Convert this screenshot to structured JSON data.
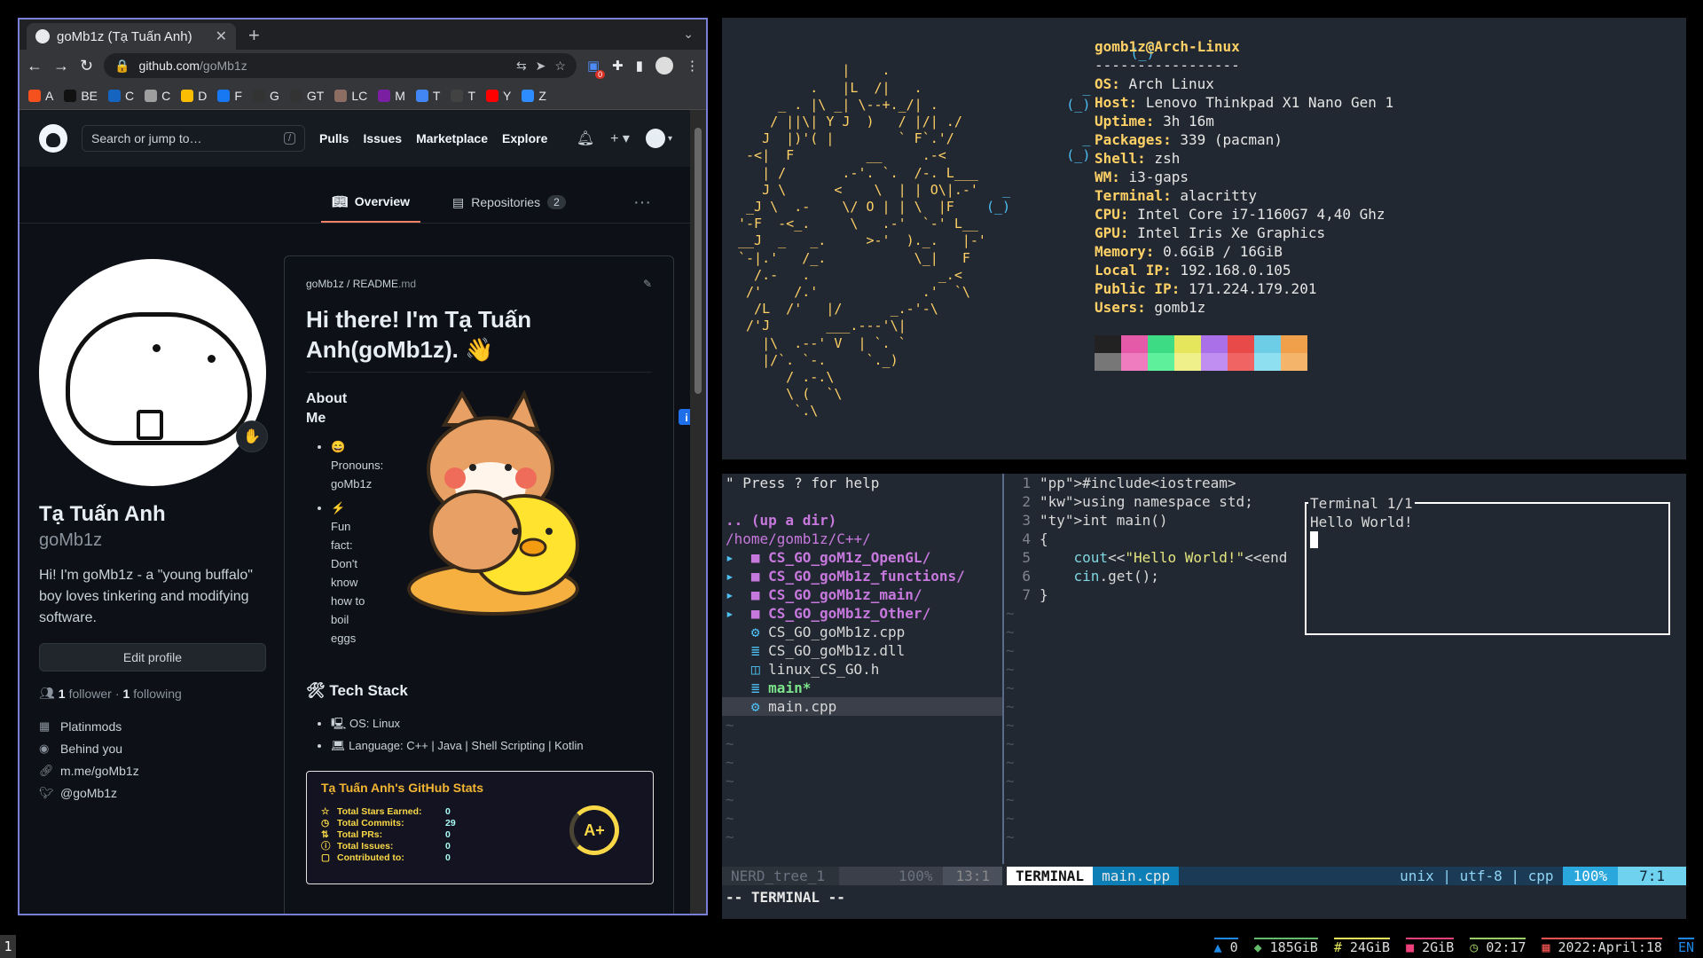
{
  "browser": {
    "tab_title": "goMb1z (Tạ Tuấn Anh)",
    "url_host": "github.com",
    "url_path": "/goMb1z",
    "bookmarks": [
      {
        "label": "A",
        "color": "#f4511e"
      },
      {
        "label": "BE",
        "color": "#111111"
      },
      {
        "label": "C",
        "color": "#1565c0"
      },
      {
        "label": "C",
        "color": "#9e9e9e"
      },
      {
        "label": "D",
        "color": "#fbbc04"
      },
      {
        "label": "F",
        "color": "#1877f2"
      },
      {
        "label": "G",
        "color": "#333333"
      },
      {
        "label": "GT",
        "color": "#333333"
      },
      {
        "label": "LC",
        "color": "#8d6e63"
      },
      {
        "label": "M",
        "color": "#7b1fa2"
      },
      {
        "label": "T",
        "color": "#4285f4"
      },
      {
        "label": "T",
        "color": "#424242"
      },
      {
        "label": "Y",
        "color": "#ff0000"
      },
      {
        "label": "Z",
        "color": "#2d8cff"
      }
    ],
    "ext_badge": "0"
  },
  "github": {
    "search_placeholder": "Search or jump to…",
    "search_key": "/",
    "nav": [
      "Pulls",
      "Issues",
      "Marketplace",
      "Explore"
    ],
    "tabs": {
      "overview": "Overview",
      "repositories": "Repositories",
      "repo_count": "2"
    },
    "profile": {
      "name": "Tạ Tuấn Anh",
      "login": "goMb1z",
      "bio": "Hi! I'm goMb1z - a \"young buffalo\" boy loves tinkering and modifying software.",
      "edit": "Edit profile",
      "followers": "1",
      "followers_label": "follower",
      "following": "1",
      "following_label": "following",
      "org": "Platinmods",
      "location": "Behind you",
      "link": "m.me/goMb1z",
      "twitter": "@goMb1z"
    },
    "readme": {
      "owner": "goMb1z",
      "file": "README",
      "ext": ".md",
      "heading": "Hi there! I'm Tạ Tuấn Anh(goMb1z). 👋",
      "about_title": "About Me",
      "about_items": [
        "😄 Pronouns: goMb1z",
        "⚡ Fun fact: Don't know how to boil eggs"
      ],
      "tech_title": "Tech Stack",
      "tech_items": [
        "OS: Linux",
        "Language: C++ | Java | Shell Scripting | Kotlin"
      ],
      "stats": {
        "title": "Tạ Tuấn Anh's GitHub Stats",
        "rows": [
          {
            "label": "Total Stars Earned:",
            "value": "0"
          },
          {
            "label": "Total Commits:",
            "value": "29"
          },
          {
            "label": "Total PRs:",
            "value": "0"
          },
          {
            "label": "Total Issues:",
            "value": "0"
          },
          {
            "label": "Contributed to:",
            "value": "0"
          }
        ],
        "grade": "A+"
      }
    }
  },
  "neofetch": {
    "user_host": "gomb1z@Arch-Linux",
    "separator": "-----------------",
    "fields": [
      {
        "k": "OS",
        "v": "Arch Linux"
      },
      {
        "k": "Host",
        "v": "Lenovo Thinkpad X1 Nano Gen 1"
      },
      {
        "k": "Uptime",
        "v": "3h 16m"
      },
      {
        "k": "Packages",
        "v": "339 (pacman)"
      },
      {
        "k": "Shell",
        "v": "zsh"
      },
      {
        "k": "WM",
        "v": "i3-gaps"
      },
      {
        "k": "Terminal",
        "v": "alacritty"
      },
      {
        "k": "CPU",
        "v": "Intel Core i7-1160G7 4,40 Ghz"
      },
      {
        "k": "GPU",
        "v": "Intel Iris Xe Graphics"
      },
      {
        "k": "Memory",
        "v": "0.6GiB / 16GiB"
      },
      {
        "k": "Local IP",
        "v": "192.168.0.105"
      },
      {
        "k": "Public IP",
        "v": "171.224.179.201"
      },
      {
        "k": "Users",
        "v": "gomb1z"
      }
    ],
    "colors_top": [
      "#222222",
      "#e55aa8",
      "#3ddc84",
      "#e6e65c",
      "#a970e8",
      "#e84a4a",
      "#6ecde6",
      "#f0a04b"
    ],
    "colors_bottom": [
      "#777777",
      "#f07cc0",
      "#5ef09a",
      "#f0f08a",
      "#c08ef0",
      "#f06464",
      "#8ee0f0",
      "#f4b46a"
    ]
  },
  "vim": {
    "help": "\" Press ? for help",
    "updir": ".. (up a dir)",
    "cwd": "/home/gomb1z/C++/",
    "entries": [
      {
        "type": "dir",
        "name": "CS_GO_goM1z_OpenGL/"
      },
      {
        "type": "dir",
        "name": "CS_GO_goMb1z_functions/"
      },
      {
        "type": "dir",
        "name": "CS_GO_goMb1z_main/"
      },
      {
        "type": "dir",
        "name": "CS_GO_goMb1z_Other/"
      },
      {
        "type": "file",
        "icon": "⚙",
        "name": "CS_GO_goMb1z.cpp"
      },
      {
        "type": "file",
        "icon": "≣",
        "name": "CS_GO_goMb1z.dll"
      },
      {
        "type": "file",
        "icon": "◫",
        "name": "linux_CS_GO.h"
      },
      {
        "type": "exe",
        "icon": "≣",
        "name": "main*"
      },
      {
        "type": "file",
        "icon": "⚙",
        "name": "main.cpp"
      }
    ],
    "code": [
      "#include<iostream>",
      "using namespace std;",
      "int main()",
      "{",
      "    cout<<\"Hello World!\"<<end",
      "    cin.get();",
      "}"
    ],
    "term_title": "Terminal 1/1",
    "term_out": "Hello World!",
    "status_left": {
      "name": "NERD_tree_1",
      "pct": "100%",
      "pos": "13:1"
    },
    "status_right": {
      "mode": "TERMINAL",
      "file": "main.cpp",
      "enc": "unix | utf-8 | cpp",
      "pct": "100%",
      "pos": "7:1"
    },
    "modeline": "-- TERMINAL --"
  },
  "bar": {
    "workspace": "1",
    "blocks": [
      {
        "icon": "▲",
        "text": "0",
        "color": "#1e88e5"
      },
      {
        "icon": "◆",
        "text": "185GiB",
        "color": "#66bb6a"
      },
      {
        "icon": "#",
        "text": "24GiB",
        "color": "#e6e65c"
      },
      {
        "icon": "■",
        "text": "2GiB",
        "color": "#ec407a"
      },
      {
        "icon": "◷",
        "text": "02:17",
        "color": "#9ccc65"
      },
      {
        "icon": "▦",
        "text": "2022:April:18",
        "color": "#ef5350"
      },
      {
        "icon": "",
        "text": "EN",
        "color": "#1e88e5"
      }
    ]
  }
}
